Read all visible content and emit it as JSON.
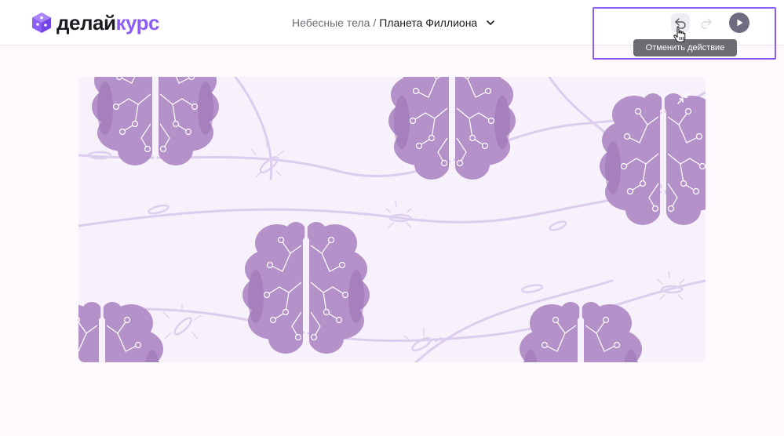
{
  "app": {
    "logo_part1": "делай",
    "logo_part2": "курс"
  },
  "breadcrumb": {
    "parent": "Небесные тела",
    "separator": "/",
    "current": "Планета Филлиона"
  },
  "toolbar": {
    "undo_icon": "undo-arrow-icon",
    "redo_icon": "redo-arrow-icon",
    "play_icon": "play-icon",
    "tooltip": "Отменить действие"
  },
  "colors": {
    "accent": "#8b5cf6",
    "brain": "#b491c8",
    "brain_dark": "#9a72b5",
    "background": "#f6f1fa",
    "line": "#dccdef"
  }
}
